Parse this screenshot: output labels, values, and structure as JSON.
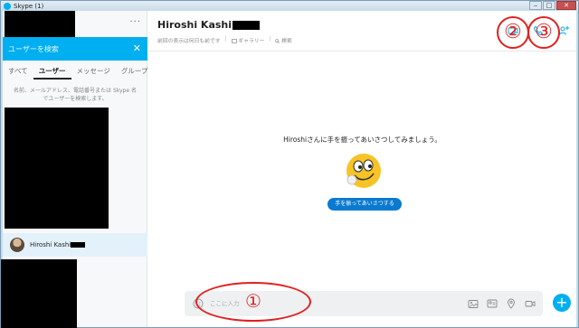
{
  "window": {
    "title": "Skype (1)",
    "minimize": "‒",
    "maximize": "□",
    "close": "✕"
  },
  "sidebar": {
    "more": "...",
    "search_placeholder": "ユーザーを検索",
    "search_close": "✕",
    "tabs": [
      {
        "label": "すべて"
      },
      {
        "label": "ユーザー",
        "active": true
      },
      {
        "label": "メッセージ"
      },
      {
        "label": "グループ"
      }
    ],
    "hint": "名前、メールアドレス、電話番号または Skype 名でユーザーを検索します。",
    "contact_name": "Hiroshi Kashi"
  },
  "header": {
    "title": "Hiroshi Kashi",
    "last_seen": "前回の表示は何日も前です",
    "gallery": "ギャラリー",
    "search": "検索"
  },
  "conversation": {
    "greeting": "Hiroshiさんに手を振ってあいさつしてみましょう。",
    "wave_button": "手を振ってあいさつする"
  },
  "compose": {
    "placeholder": "ここに入力",
    "send": "+"
  },
  "annotations": {
    "one": "①",
    "two": "②",
    "three": "③"
  },
  "icons": {
    "emoticon": "smile-emoticon-icon",
    "header": [
      "video-call-icon",
      "audio-call-icon",
      "add-participant-icon"
    ],
    "compose": [
      "image-icon",
      "contact-card-icon",
      "location-icon",
      "video-message-icon"
    ]
  },
  "colors": {
    "accent": "#00aff0",
    "button": "#0a7ad0",
    "annotation": "#e02020"
  }
}
